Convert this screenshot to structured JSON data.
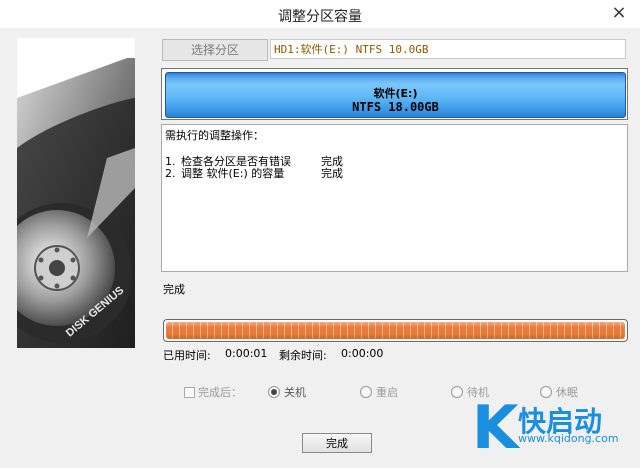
{
  "window": {
    "title": "调整分区容量",
    "close_label": "×"
  },
  "toolbar": {
    "select_partition_label": "选择分区"
  },
  "disk_info": {
    "text": "HD1:软件(E:) NTFS 10.0GB"
  },
  "partition": {
    "name": "软件(E:)",
    "size_text": "NTFS 18.00GB",
    "color": "#4aa8ef"
  },
  "operations": {
    "header": "需执行的调整操作：",
    "items": [
      {
        "num": "1.",
        "task": "检查各分区是否有错误",
        "status": "完成"
      },
      {
        "num": "2.",
        "task": "调整 软件(E:) 的容量",
        "status": "完成"
      }
    ]
  },
  "status_text": "完成",
  "progress": {
    "fraction": 1.0,
    "color": "#e97b3a"
  },
  "times": {
    "elapsed_label": "已用时间:",
    "elapsed_value": "0:00:01",
    "remaining_label": "剩余时间:",
    "remaining_value": "0:00:00"
  },
  "after_completion": {
    "label": "完成后：",
    "options": [
      {
        "label": "关机",
        "checked": true
      },
      {
        "label": "重启",
        "checked": false
      },
      {
        "label": "待机",
        "checked": false
      },
      {
        "label": "休眠",
        "checked": false
      }
    ]
  },
  "buttons": {
    "done_label": "完成"
  },
  "watermark": {
    "letter": "K",
    "brand": "快启动",
    "url": "www.kqidong.com",
    "color": "#1a8fe0"
  },
  "disk_image": {
    "logo_text": "DISK GENIUS"
  }
}
